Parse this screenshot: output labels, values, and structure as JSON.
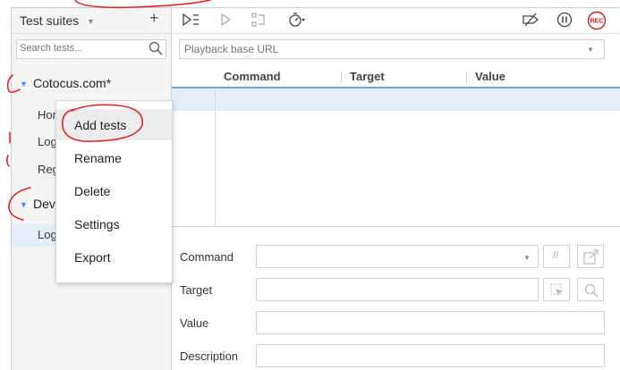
{
  "sidebar": {
    "title": "Test suites",
    "search_placeholder": "Search tests...",
    "suites": [
      {
        "name": "Cotocus.com*",
        "tests": [
          "Hor",
          "Log",
          "Reg"
        ]
      },
      {
        "name": "Dev",
        "tests": [
          "Log"
        ]
      }
    ]
  },
  "context_menu": {
    "items": [
      "Add tests",
      "Rename",
      "Delete",
      "Settings",
      "Export"
    ],
    "highlighted": "Add tests"
  },
  "toolbar": {
    "icons": [
      "run-all-icon",
      "run-current-icon",
      "step-icon",
      "speed-icon",
      "disable-breakpoints-icon",
      "pause-icon",
      "record-icon"
    ],
    "record_label": "REC"
  },
  "playback": {
    "placeholder": "Playback base URL"
  },
  "grid": {
    "columns": [
      "Command",
      "Target",
      "Value"
    ]
  },
  "editor": {
    "fields": [
      "Command",
      "Target",
      "Value",
      "Description"
    ],
    "comment_toggle": "//"
  },
  "colors": {
    "accent": "#3a8ee6",
    "annotation": "#e02424",
    "selection": "#e3eefa"
  }
}
